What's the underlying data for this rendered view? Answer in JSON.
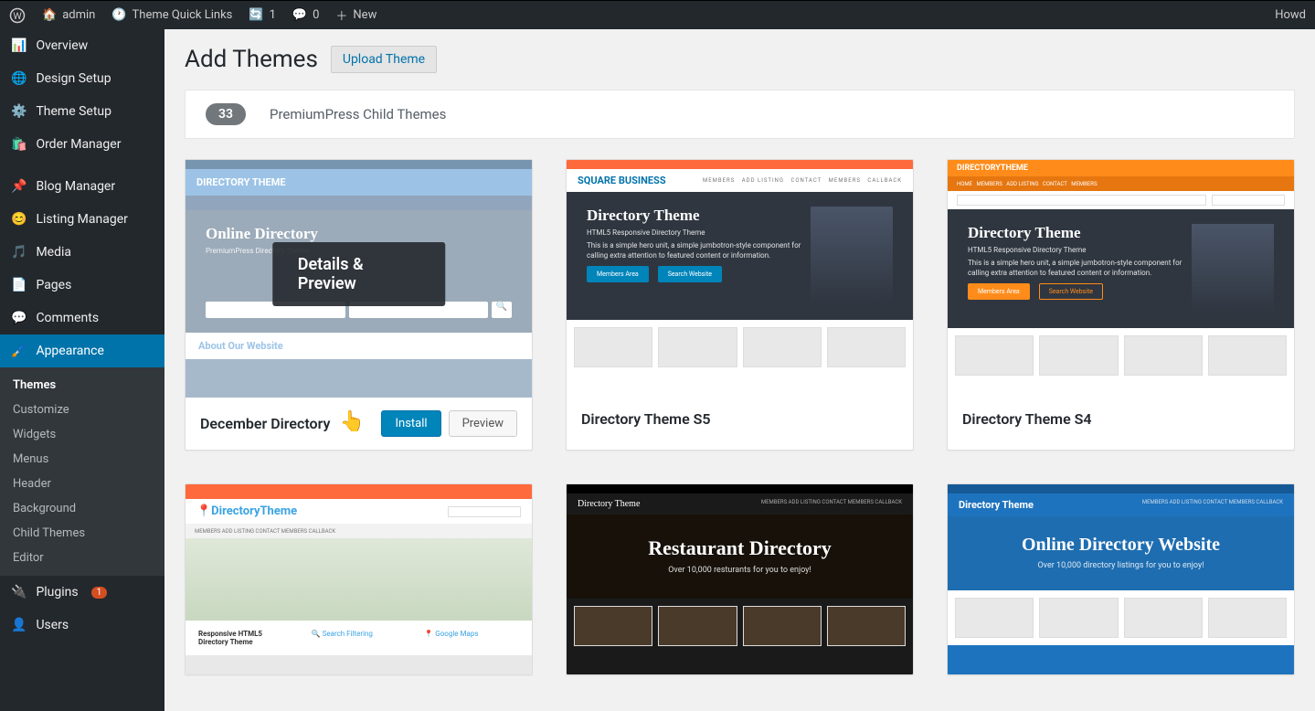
{
  "adminbar": {
    "site_name": "admin",
    "quick_links": "Theme Quick Links",
    "updates_count": "1",
    "comments_count": "0",
    "new_label": "New",
    "howdy": "Howd"
  },
  "sidebar": {
    "items": [
      {
        "label": "Overview"
      },
      {
        "label": "Design Setup"
      },
      {
        "label": "Theme Setup"
      },
      {
        "label": "Order Manager"
      },
      {
        "label": "Blog Manager"
      },
      {
        "label": "Listing Manager"
      },
      {
        "label": "Media"
      },
      {
        "label": "Pages"
      },
      {
        "label": "Comments"
      },
      {
        "label": "Appearance"
      },
      {
        "label": "Plugins",
        "badge": "1"
      },
      {
        "label": "Users"
      }
    ],
    "appearance_submenu": [
      "Themes",
      "Customize",
      "Widgets",
      "Menus",
      "Header",
      "Background",
      "Child Themes",
      "Editor"
    ]
  },
  "page": {
    "title": "Add Themes",
    "upload_label": "Upload Theme",
    "count": "33",
    "filter_label": "PremiumPress Child Themes"
  },
  "themes": [
    {
      "name": "December Directory",
      "hovered": true,
      "overlay": "Details & Preview",
      "install": "Install",
      "preview": "Preview"
    },
    {
      "name": "Directory Theme S5"
    },
    {
      "name": "Directory Theme S4"
    },
    {
      "name": ""
    },
    {
      "name": ""
    },
    {
      "name": ""
    }
  ],
  "mock": {
    "t0": {
      "topcolor": "#5a9bd5",
      "logo": "DIRECTORY THEME",
      "logocolor": "#fff",
      "hero_title": "Online Directory",
      "hero_sub": "PremiumPress Directory Theme",
      "about": "About Our Website"
    },
    "t1": {
      "logo": "SQUARE BUSINESS",
      "logocolor": "#0073aa",
      "hero_title": "Directory Theme",
      "hero_sub": "HTML5 Responsive Directory Theme",
      "hero_desc": "This is a simple hero unit, a simple jumbotron-style component for calling extra attention to featured content or information.",
      "pill1": "Members Area",
      "pill2": "Search Website"
    },
    "t2": {
      "topcolor": "#ff8c1a",
      "logo": "DIRECTORYTHEME",
      "hero_title": "Directory Theme",
      "hero_sub": "HTML5 Responsive Directory Theme",
      "hero_desc": "This is a simple hero unit, a simple jumbotron-style component for calling extra attention to featured content or information.",
      "pill1": "Members Area",
      "pill2": "Search Website"
    },
    "t3": {
      "topcolor": "#ff6a3d",
      "logo": "📍DirectoryTheme",
      "hero_title": "Responsive HTML5 Directory Theme",
      "col2": "Search Filtering",
      "col3": "Google Maps"
    },
    "t4": {
      "logo": "Directory Theme",
      "hero_title": "Restaurant Directory",
      "hero_sub": "Over 10,000 resturants for you to enjoy!"
    },
    "t5": {
      "topcolor": "#1e73be",
      "logo": "Directory Theme",
      "hero_title": "Online Directory Website",
      "hero_sub": "Over 10,000 directory listings for you to enjoy!"
    }
  }
}
